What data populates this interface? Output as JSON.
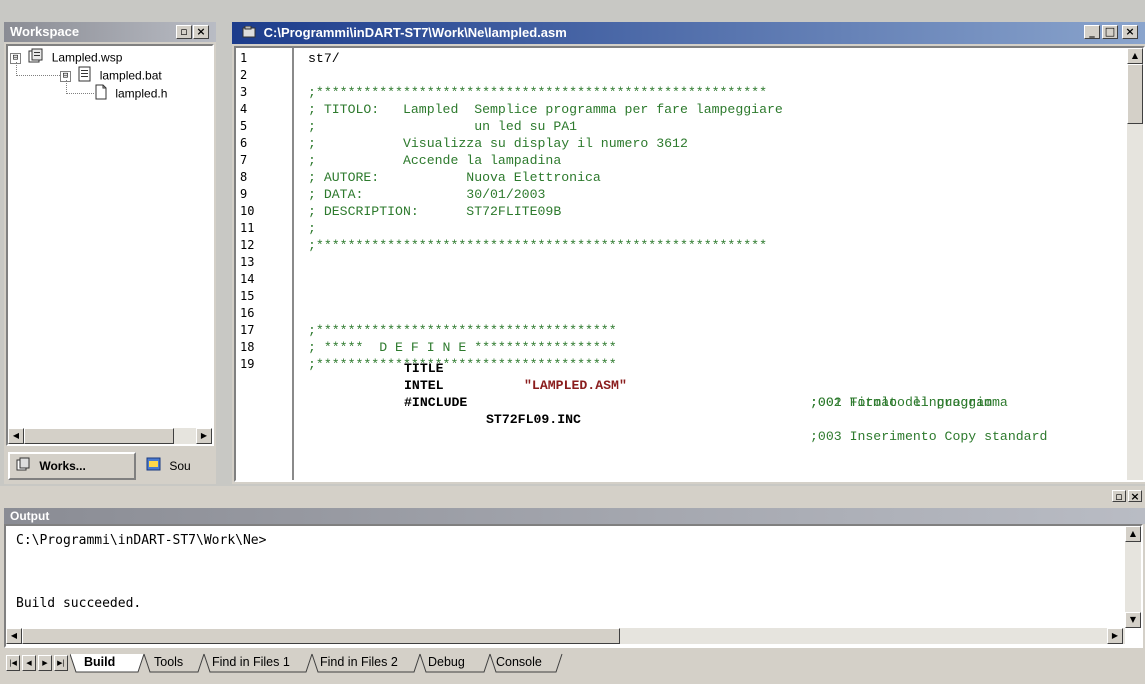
{
  "workspace": {
    "title": "Workspace",
    "tree": [
      {
        "label": "Lampled.wsp",
        "expander": "⊟",
        "icon": "workspace-icon"
      },
      {
        "label": "lampled.bat",
        "expander": "⊟",
        "icon": "batch-file-icon"
      },
      {
        "label": "lampled.h",
        "expander": "",
        "icon": "document-icon"
      }
    ],
    "tabs": [
      {
        "label": "Works...",
        "icon": "workspace-tab-icon"
      },
      {
        "label": "Sou",
        "icon": "source-tab-icon"
      }
    ]
  },
  "editor": {
    "title": "C:\\Programmi\\inDART-ST7\\Work\\Ne\\lampled.asm",
    "line_numbers": [
      "1",
      "2",
      "3",
      "4",
      "5",
      "6",
      "7",
      "8",
      "9",
      "10",
      "11",
      "12",
      "13",
      "14",
      "15",
      "16",
      "17",
      "18",
      "19"
    ],
    "lines": [
      "st7/",
      "",
      ";*********************************************************",
      "; TITOLO:   Lampled  Semplice programma per fare lampeggiare",
      ";                    un led su PA1",
      ";           Visualizza su display il numero 3612",
      ";           Accende la lampadina",
      "; AUTORE:           Nuova Elettronica",
      "; DATA:             30/01/2003",
      "; DESCRIPTION:      ST72FLITE09B",
      ";",
      ";*********************************************************",
      "",
      "",
      "",
      "",
      ";**************************************",
      "; *****  D E F I N E ******************",
      ";**************************************"
    ],
    "directives": [
      {
        "keyword": "TITLE",
        "arg": "\"LAMPLED.ASM\"",
        "comment": ";001 Titolo del programma"
      },
      {
        "keyword": "INTEL",
        "arg": "",
        "comment": ";002 Formato linguaggio"
      },
      {
        "keyword": "#INCLUDE",
        "arg": "ST72FL09.INC",
        "comment": ";003 Inserimento Copy standard"
      }
    ]
  },
  "output": {
    "title": "Output",
    "lines": [
      "C:\\Programmi\\inDART-ST7\\Work\\Ne>",
      "",
      "",
      "Build succeeded."
    ],
    "tabs": [
      "Build",
      "Tools",
      "Find in Files 1",
      "Find in Files 2",
      "Debug",
      "Console"
    ]
  },
  "window_buttons": {
    "minimize": "_",
    "maximize": "□",
    "close": "×"
  },
  "colors": {
    "comment": "#2d7a2d",
    "string": "#8a1c1c",
    "active_title": "#1c3c8c"
  }
}
